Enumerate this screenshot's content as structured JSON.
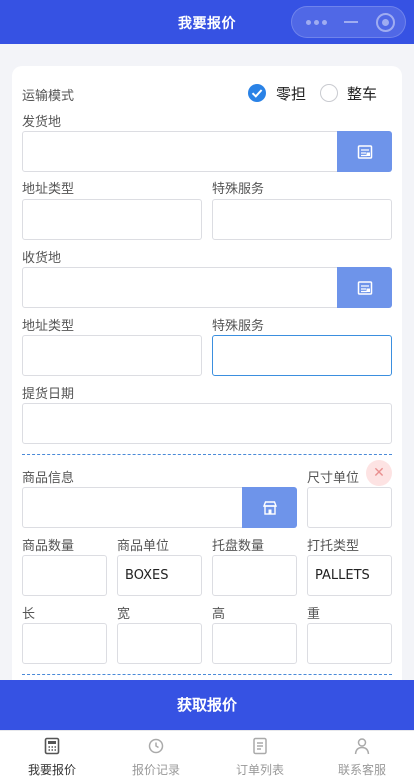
{
  "header": {
    "title": "我要报价"
  },
  "form": {
    "transport_mode_label": "运输模式",
    "transport_options": [
      {
        "label": "零担",
        "checked": true
      },
      {
        "label": "整车",
        "checked": false
      }
    ],
    "origin_label": "发货地",
    "origin_value": "",
    "origin_address_type_label": "地址类型",
    "origin_address_type_value": "",
    "origin_special_service_label": "特殊服务",
    "origin_special_service_value": "",
    "destination_label": "收货地",
    "destination_value": "",
    "destination_address_type_label": "地址类型",
    "destination_address_type_value": "",
    "destination_special_service_label": "特殊服务",
    "destination_special_service_value": "",
    "pickup_date_label": "提货日期",
    "pickup_date_value": "",
    "goods_info_label": "商品信息",
    "goods_info_value": "",
    "size_unit_label": "尺寸单位",
    "size_unit_value": "",
    "goods_quantity_label": "商品数量",
    "goods_quantity_value": "",
    "goods_unit_label": "商品单位",
    "goods_unit_value": "BOXES",
    "pallet_quantity_label": "托盘数量",
    "pallet_quantity_value": "",
    "pallet_type_label": "打托类型",
    "pallet_type_value": "PALLETS",
    "length_label": "长",
    "length_value": "",
    "width_label": "宽",
    "width_value": "",
    "height_label": "高",
    "height_value": "",
    "weight_label": "重",
    "weight_value": ""
  },
  "submit": {
    "label": "获取报价"
  },
  "tabs": [
    {
      "label": "我要报价",
      "icon": "calculator-icon",
      "active": true
    },
    {
      "label": "报价记录",
      "icon": "history-icon",
      "active": false
    },
    {
      "label": "订单列表",
      "icon": "order-list-icon",
      "active": false
    },
    {
      "label": "联系客服",
      "icon": "user-icon",
      "active": false
    }
  ],
  "colors": {
    "primary": "#3652e3",
    "button_blue": "#6e94ea",
    "radio_checked": "#2a82e6",
    "dashed_divider": "#4a8ad8",
    "delete_red": "#e98f8f"
  }
}
